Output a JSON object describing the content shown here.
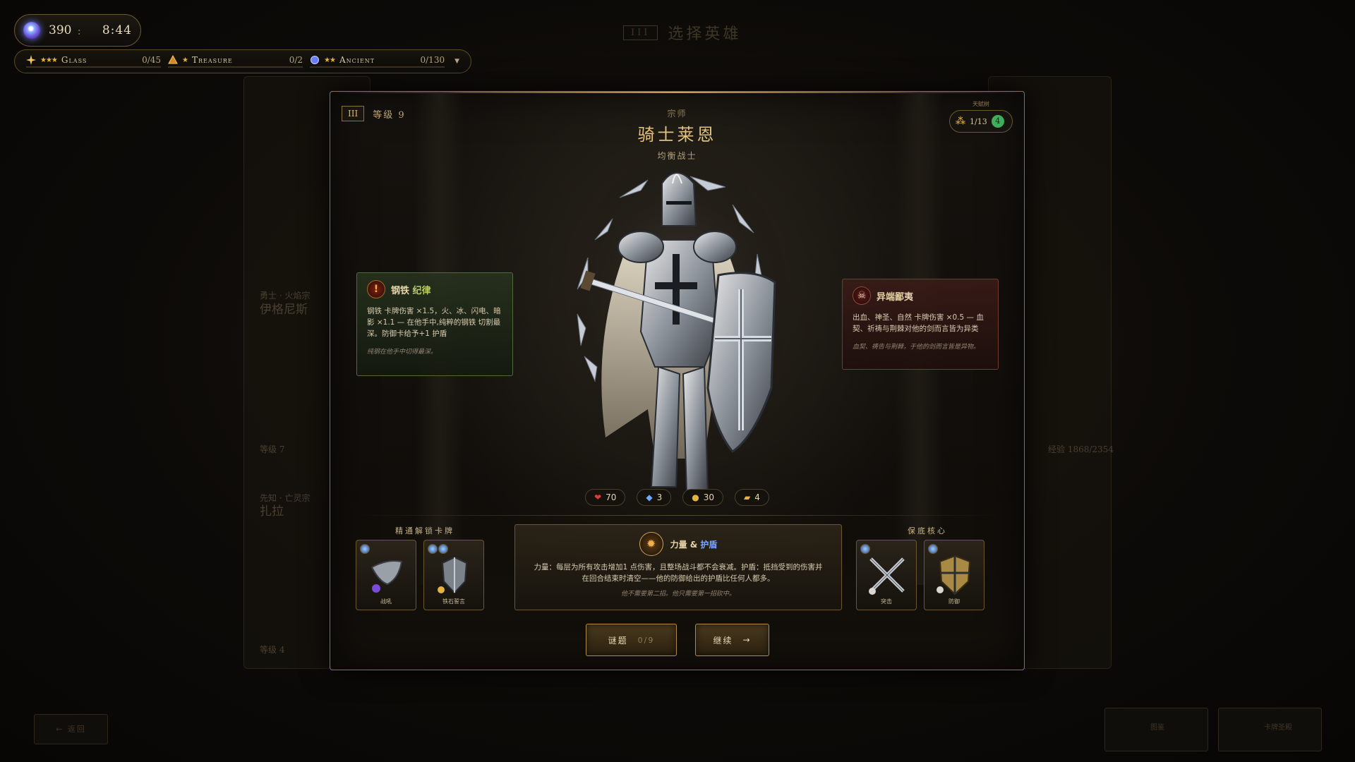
{
  "hud": {
    "gems": "390",
    "separator": ":",
    "time": "8:44"
  },
  "resources": [
    {
      "stars": "★★★",
      "name": "Glass",
      "count": "0/45",
      "icon": "sparkle-icon"
    },
    {
      "stars": "★",
      "name": "Treasure",
      "count": "0/2",
      "icon": "treasure-icon"
    },
    {
      "stars": "★★",
      "name": "Ancient",
      "count": "0/130",
      "icon": "ancient-gem-icon"
    }
  ],
  "page": {
    "badge": "III",
    "title": "选择英雄"
  },
  "hero": {
    "tier_badge": "III",
    "level_label": "等级 9",
    "rank": "宗师",
    "name": "骑士莱恩",
    "class": "均衡战士",
    "talent_label": "天赋树",
    "talent_count": "1/13",
    "talent_plus": "4"
  },
  "ability_left": {
    "title_a": "钢铁",
    "title_b": "纪律",
    "line1": "钢铁 卡牌伤害 ×1.5，火、冰、闪电、暗影 ×1.1 — 在他手中,纯粹的钢铁 切割最深。防御卡给予+1 护盾",
    "note": "纯钢在他手中切得最深。"
  },
  "ability_right": {
    "title": "异端鄙夷",
    "body": "出血、神圣、自然 卡牌伤害 ×0.5 — 血契、祈祷与荆棘对他的剑而言皆为异类",
    "note": "血契、祷告与荆棘，于他的剑而言皆是异物。"
  },
  "stats": [
    {
      "icon": "heart-icon",
      "value": "70",
      "color": "#e03a3a"
    },
    {
      "icon": "mana-icon",
      "value": "3",
      "color": "#6ea8ff"
    },
    {
      "icon": "gold-icon",
      "value": "30",
      "color": "#e6b340"
    },
    {
      "icon": "card-icon",
      "value": "4",
      "color": "#e6b340"
    }
  ],
  "unlock": {
    "label": "精通解锁卡牌",
    "cards": [
      {
        "name": "战吼",
        "icon": "war-horn-icon"
      },
      {
        "name": "铁石誓言",
        "icon": "iron-shield-icon"
      }
    ]
  },
  "core": {
    "title_a": "力量",
    "amp": "&",
    "title_b": "护盾",
    "body": "力量：每层为所有攻击增加1 点伤害，且整场战斗都不会衰减。护盾：抵挡受到的伤害并在回合结束时清空——他的防御给出的护盾比任何人都多。",
    "note": "他不需要第二招。他只需要第一招砍中。"
  },
  "guarantee": {
    "label": "保底核心",
    "cards": [
      {
        "name": "突击",
        "icon": "crossed-swords-icon"
      },
      {
        "name": "防御",
        "icon": "shield-icon"
      }
    ]
  },
  "buttons": {
    "riddle": "谜题",
    "riddle_count": "0/9",
    "continue": "继续"
  },
  "background": {
    "left_hero_name": "伊格尼斯",
    "left_hero_tag": "勇士 · 火焰宗",
    "left_lvl": "等级 7",
    "left_hero2_name": "扎拉",
    "left_hero2_tag": "先知 · 亡灵宗",
    "left_lvl2": "等级 4",
    "right_lvl": "经验 1868/2354",
    "back": "返回",
    "footer_card_a": "图鉴",
    "footer_card_b": "卡牌圣殿"
  }
}
